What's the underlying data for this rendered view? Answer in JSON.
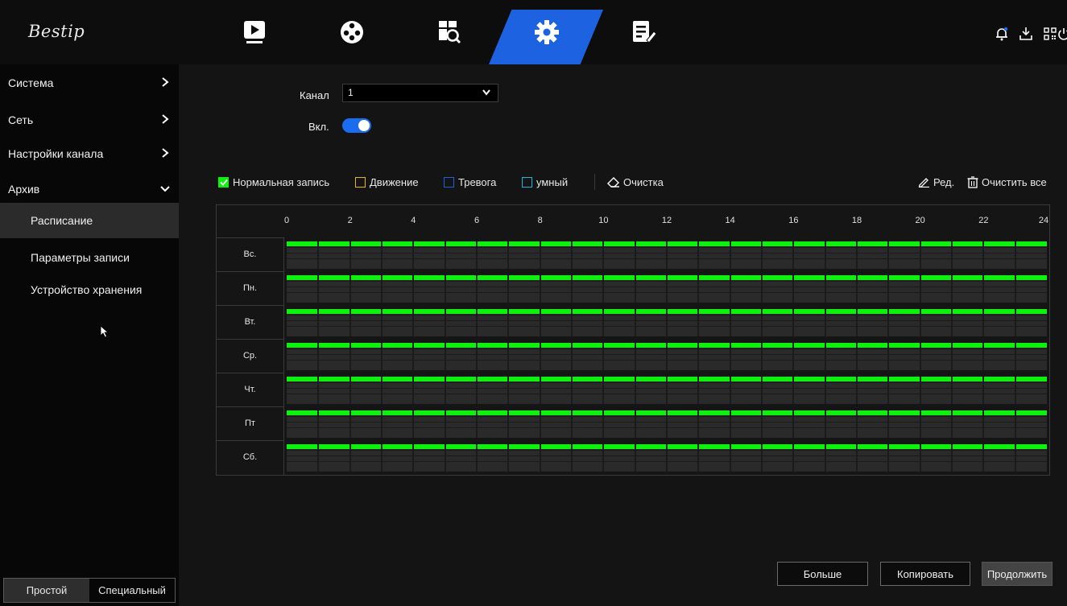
{
  "app": {
    "logo_text": "Bestip"
  },
  "top_nav": {
    "items": [
      {
        "name": "playback",
        "icon": "playback-icon"
      },
      {
        "name": "ai",
        "icon": "film-reel-icon"
      },
      {
        "name": "search",
        "icon": "search-file-icon"
      },
      {
        "name": "settings",
        "icon": "gear-icon",
        "active": true
      },
      {
        "name": "maintenance",
        "icon": "document-edit-icon"
      }
    ],
    "tools": [
      "bell-icon",
      "download-icon",
      "qr-icon",
      "power-icon"
    ],
    "accent_color": "#1d63e1"
  },
  "sidebar": {
    "items": [
      {
        "label": "Система",
        "chevron": "right"
      },
      {
        "label": "Сеть",
        "chevron": "right"
      },
      {
        "label": "Настройки канала",
        "chevron": "right"
      },
      {
        "label": "Архив",
        "chevron": "down"
      }
    ],
    "subitems": [
      {
        "label": "Расписание",
        "active": true
      },
      {
        "label": "Параметры записи"
      },
      {
        "label": "Устройство хранения"
      }
    ],
    "modes": [
      {
        "label": "Простой",
        "active": true
      },
      {
        "label": "Специальный"
      }
    ]
  },
  "form": {
    "channel_label": "Канал",
    "channel_value": "1",
    "enable_label": "Вкл.",
    "enable_on": true
  },
  "legend": {
    "items": [
      {
        "label": "Нормальная запись",
        "checked": true,
        "color": "#0ef00e"
      },
      {
        "label": "Движение",
        "checked": false,
        "color": "#e6b800"
      },
      {
        "label": "Тревога",
        "checked": false,
        "color": "#1f5fd8"
      },
      {
        "label": "умный",
        "checked": false,
        "color": "#1ab6e6"
      }
    ],
    "clear_label": "Очистка",
    "edit_label": "Ред.",
    "clear_all_label": "Очистить все"
  },
  "schedule": {
    "hour_labels": [
      "0",
      "2",
      "4",
      "6",
      "8",
      "10",
      "12",
      "14",
      "16",
      "18",
      "20",
      "22",
      "24"
    ],
    "days": [
      "Вс.",
      "Пн.",
      "Вт.",
      "Ср.",
      "Чт.",
      "Пт",
      "Сб."
    ],
    "normal_record_hours": [
      [
        0,
        24
      ],
      [
        0,
        24
      ],
      [
        0,
        24
      ],
      [
        0,
        24
      ],
      [
        0,
        24
      ],
      [
        0,
        24
      ],
      [
        0,
        24
      ]
    ],
    "bar_color": "#0ef00e"
  },
  "buttons": {
    "more": "Больше",
    "copy": "Копировать",
    "continue": "Продолжить"
  }
}
